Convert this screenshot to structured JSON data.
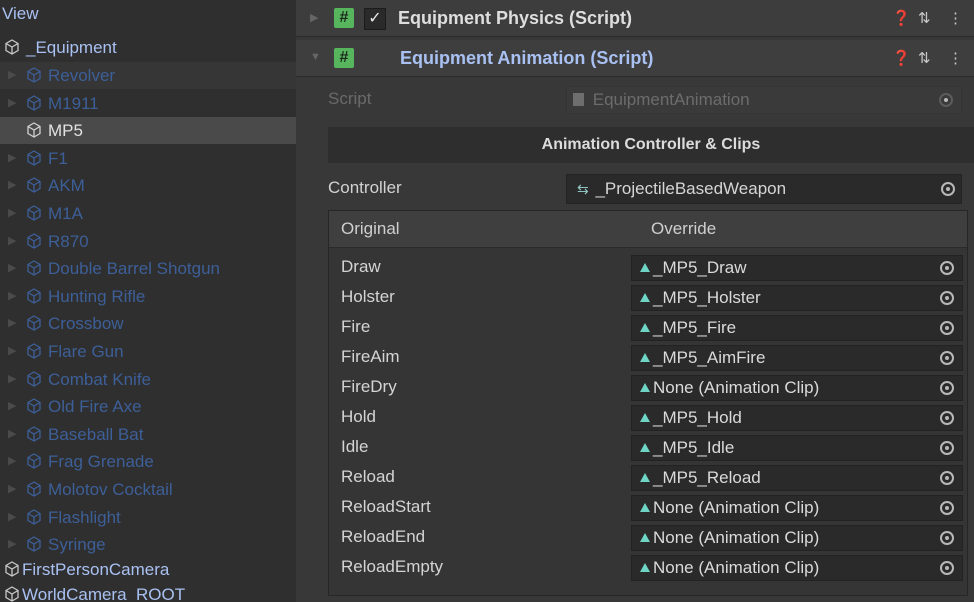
{
  "hierarchy": {
    "header": "View",
    "parent": "_Equipment",
    "children": [
      {
        "label": "Revolver",
        "state": "dim",
        "selected": true
      },
      {
        "label": "M1911",
        "state": "dim"
      },
      {
        "label": "MP5",
        "state": "bright",
        "selected": true
      },
      {
        "label": "F1",
        "state": "dim"
      },
      {
        "label": "AKM",
        "state": "dim"
      },
      {
        "label": "M1A",
        "state": "dim"
      },
      {
        "label": "R870",
        "state": "dim"
      },
      {
        "label": "Double Barrel Shotgun",
        "state": "dim"
      },
      {
        "label": "Hunting Rifle",
        "state": "dim"
      },
      {
        "label": "Crossbow",
        "state": "dim"
      },
      {
        "label": "Flare Gun",
        "state": "dim"
      },
      {
        "label": "Combat Knife",
        "state": "dim"
      },
      {
        "label": "Old Fire Axe",
        "state": "dim"
      },
      {
        "label": "Baseball Bat",
        "state": "dim"
      },
      {
        "label": "Frag Grenade",
        "state": "dim"
      },
      {
        "label": "Molotov Cocktail",
        "state": "dim"
      },
      {
        "label": "Flashlight",
        "state": "dim"
      },
      {
        "label": "Syringe",
        "state": "dim"
      }
    ],
    "roots": [
      "FirstPersonCamera",
      "WorldCamera_ROOT"
    ]
  },
  "inspector": {
    "physics_component": {
      "title": "Equipment Physics (Script)",
      "checked": true,
      "check_mark": "✓",
      "hash": "#"
    },
    "animation_component": {
      "title": "Equipment Animation (Script)",
      "hash": "#"
    },
    "script_label": "Script",
    "script_value": "EquipmentAnimation",
    "section_title": "Animation Controller & Clips",
    "controller_label": "Controller",
    "controller_value": "_ProjectileBasedWeapon",
    "table_headers": {
      "original": "Original",
      "override": "Override"
    },
    "clips": [
      {
        "original": "Draw",
        "override": "_MP5_Draw"
      },
      {
        "original": "Holster",
        "override": "_MP5_Holster"
      },
      {
        "original": "Fire",
        "override": "_MP5_Fire"
      },
      {
        "original": "FireAim",
        "override": "_MP5_AimFire"
      },
      {
        "original": "FireDry",
        "override": "None (Animation Clip)"
      },
      {
        "original": "Hold",
        "override": "_MP5_Hold"
      },
      {
        "original": "Idle",
        "override": "_MP5_Idle"
      },
      {
        "original": "Reload",
        "override": "_MP5_Reload"
      },
      {
        "original": "ReloadStart",
        "override": "None (Animation Clip)"
      },
      {
        "original": "ReloadEnd",
        "override": "None (Animation Clip)"
      },
      {
        "original": "ReloadEmpty",
        "override": "None (Animation Clip)"
      }
    ]
  },
  "colors": {
    "accent_green": "#57b55d",
    "title_blue": "#a9c1f2",
    "dim_blue": "#3d5f98",
    "clip_teal": "#6fd5c4"
  }
}
